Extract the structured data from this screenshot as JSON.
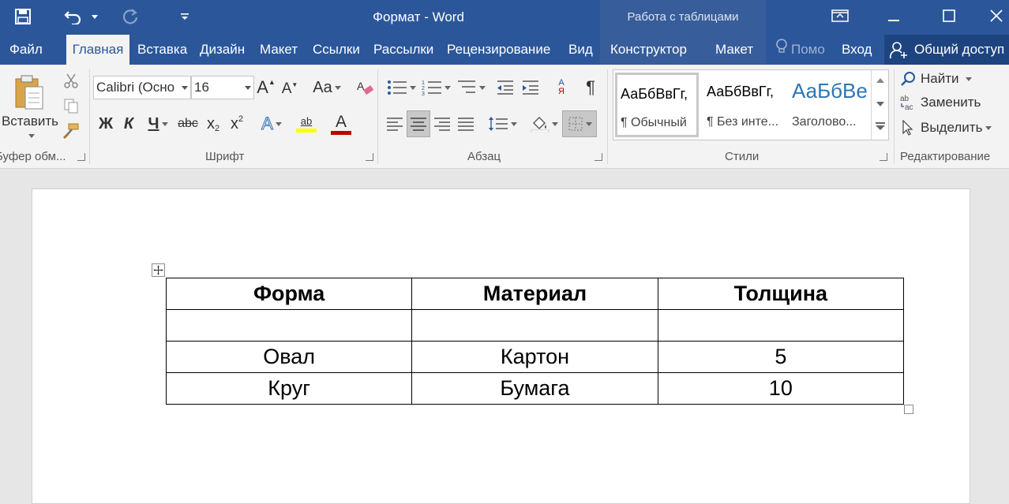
{
  "titlebar": {
    "doc_title": "Формат - Word",
    "context_label": "Работа с таблицами",
    "qat": [
      "save-icon",
      "undo-icon",
      "redo-icon",
      "customize-qat-icon"
    ],
    "window_controls": [
      "ribbon-display-icon",
      "minimize-icon",
      "maximize-icon",
      "close-icon"
    ]
  },
  "tabs": {
    "items": [
      {
        "label": "Файл"
      },
      {
        "label": "Главная"
      },
      {
        "label": "Вставка"
      },
      {
        "label": "Дизайн"
      },
      {
        "label": "Макет"
      },
      {
        "label": "Ссылки"
      },
      {
        "label": "Рассылки"
      },
      {
        "label": "Рецензирование"
      },
      {
        "label": "Вид"
      }
    ],
    "context_tabs": [
      {
        "label": "Конструктор"
      },
      {
        "label": "Макет"
      }
    ],
    "tell_me": "Помо",
    "signin": "Вход",
    "share": "Общий доступ"
  },
  "ribbon": {
    "clipboard": {
      "paste_label": "Вставить",
      "group_label": "Буфер обм..."
    },
    "font": {
      "font_name": "Calibri (Осно",
      "font_size": "16",
      "case_label": "Aa",
      "bold": "Ж",
      "italic": "К",
      "underline": "Ч",
      "strike": "abc",
      "subscript": "x",
      "subscript_mark": "2",
      "superscript": "x",
      "superscript_mark": "2",
      "grow": "A",
      "shrink": "A",
      "effects": "A",
      "highlight": "ab",
      "font_color": "A",
      "group_label": "Шрифт"
    },
    "paragraph": {
      "sort_top": "А",
      "sort_bottom": "Я",
      "pilcrow": "¶",
      "group_label": "Абзац"
    },
    "styles": {
      "items": [
        {
          "preview": "АаБбВвГг,",
          "name": "¶ Обычный"
        },
        {
          "preview": "АаБбВвГг,",
          "name": "¶ Без инте..."
        },
        {
          "preview": "АаБбВе",
          "name": "Заголово..."
        }
      ],
      "group_label": "Стили"
    },
    "editing": {
      "find": "Найти",
      "replace": "Заменить",
      "select": "Выделить",
      "group_label": "Редактирование"
    }
  },
  "document": {
    "table": {
      "headers": [
        "Форма",
        "Материал",
        "Толщина"
      ],
      "rows": [
        [
          "",
          "",
          ""
        ],
        [
          "Овал",
          "Картон",
          "5"
        ],
        [
          "Круг",
          "Бумага",
          "10"
        ]
      ]
    }
  },
  "colors": {
    "title_bar": "#2b579a",
    "context_group": "#375d9a",
    "ribbon_bg": "#f3f3f3",
    "font_color_bar": "#c00000",
    "highlight_bar": "#ffff00"
  }
}
